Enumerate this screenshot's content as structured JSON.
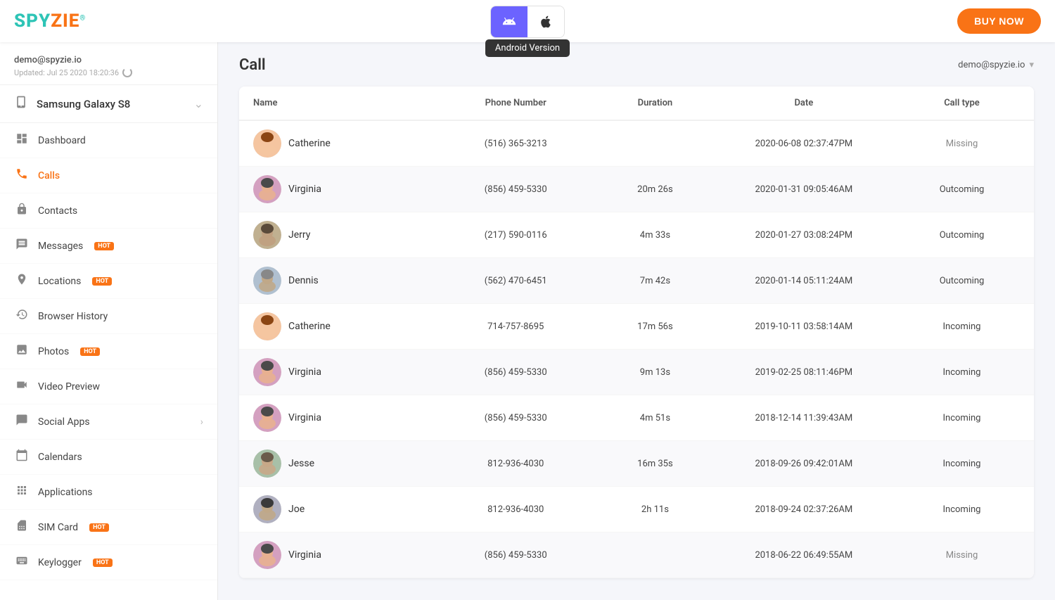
{
  "logo": {
    "spy": "SPY",
    "zie": "ZIE",
    "dot": "!"
  },
  "topbar": {
    "buy_now": "BUY NOW",
    "android_label": "Android Version",
    "account": "demo@spyzie.io"
  },
  "sidebar": {
    "email": "demo@spyzie.io",
    "updated": "Updated: Jul 25 2020 18:20:36",
    "device": "Samsung Galaxy S8",
    "nav": [
      {
        "id": "dashboard",
        "label": "Dashboard",
        "hot": false,
        "icon": "⊞"
      },
      {
        "id": "calls",
        "label": "Calls",
        "hot": false,
        "icon": "☎",
        "active": true
      },
      {
        "id": "contacts",
        "label": "Contacts",
        "hot": false,
        "icon": "🔒"
      },
      {
        "id": "messages",
        "label": "Messages",
        "hot": true,
        "icon": "💬"
      },
      {
        "id": "locations",
        "label": "Locations",
        "hot": true,
        "icon": "📍"
      },
      {
        "id": "browser-history",
        "label": "Browser History",
        "hot": false,
        "icon": "🕐"
      },
      {
        "id": "photos",
        "label": "Photos",
        "hot": true,
        "icon": "🖼"
      },
      {
        "id": "video-preview",
        "label": "Video Preview",
        "hot": false,
        "icon": "📹"
      },
      {
        "id": "social-apps",
        "label": "Social Apps",
        "hot": false,
        "icon": "💭",
        "arrow": true
      },
      {
        "id": "calendars",
        "label": "Calendars",
        "hot": false,
        "icon": "📅"
      },
      {
        "id": "applications",
        "label": "Applications",
        "hot": false,
        "icon": "⊞"
      },
      {
        "id": "sim-card",
        "label": "SIM Card",
        "hot": true,
        "icon": "📋"
      },
      {
        "id": "keylogger",
        "label": "Keylogger",
        "hot": true,
        "icon": "⌨"
      }
    ]
  },
  "main": {
    "title": "Call",
    "account_label": "demo@spyzie.io",
    "table": {
      "headers": [
        "Name",
        "Phone Number",
        "Duration",
        "Date",
        "Call type"
      ],
      "rows": [
        {
          "name": "Catherine",
          "phone": "(516) 365-3213",
          "duration": "",
          "date": "2020-06-08 02:37:47PM",
          "type": "Missing",
          "avatar": "f1"
        },
        {
          "name": "Virginia",
          "phone": "(856) 459-5330",
          "duration": "20m 26s",
          "date": "2020-01-31 09:05:46AM",
          "type": "Outcoming",
          "avatar": "f2"
        },
        {
          "name": "Jerry",
          "phone": "(217) 590-0116",
          "duration": "4m 33s",
          "date": "2020-01-27 03:08:24PM",
          "type": "Outcoming",
          "avatar": "m1"
        },
        {
          "name": "Dennis",
          "phone": "(562) 470-6451",
          "duration": "7m 42s",
          "date": "2020-01-14 05:11:24AM",
          "type": "Outcoming",
          "avatar": "m2"
        },
        {
          "name": "Catherine",
          "phone": "714-757-8695",
          "duration": "17m 56s",
          "date": "2019-10-11 03:58:14AM",
          "type": "Incoming",
          "avatar": "f1"
        },
        {
          "name": "Virginia",
          "phone": "(856) 459-5330",
          "duration": "9m 13s",
          "date": "2019-02-25 08:11:46PM",
          "type": "Incoming",
          "avatar": "f2"
        },
        {
          "name": "Virginia",
          "phone": "(856) 459-5330",
          "duration": "4m 51s",
          "date": "2018-12-14 11:39:43AM",
          "type": "Incoming",
          "avatar": "f2"
        },
        {
          "name": "Jesse",
          "phone": "812-936-4030",
          "duration": "16m 35s",
          "date": "2018-09-26 09:42:01AM",
          "type": "Incoming",
          "avatar": "m3"
        },
        {
          "name": "Joe",
          "phone": "812-936-4030",
          "duration": "2h 11s",
          "date": "2018-09-24 02:37:26AM",
          "type": "Incoming",
          "avatar": "m4"
        },
        {
          "name": "Virginia",
          "phone": "(856) 459-5330",
          "duration": "",
          "date": "2018-06-22 06:49:55AM",
          "type": "Missing",
          "avatar": "f2"
        }
      ]
    }
  }
}
